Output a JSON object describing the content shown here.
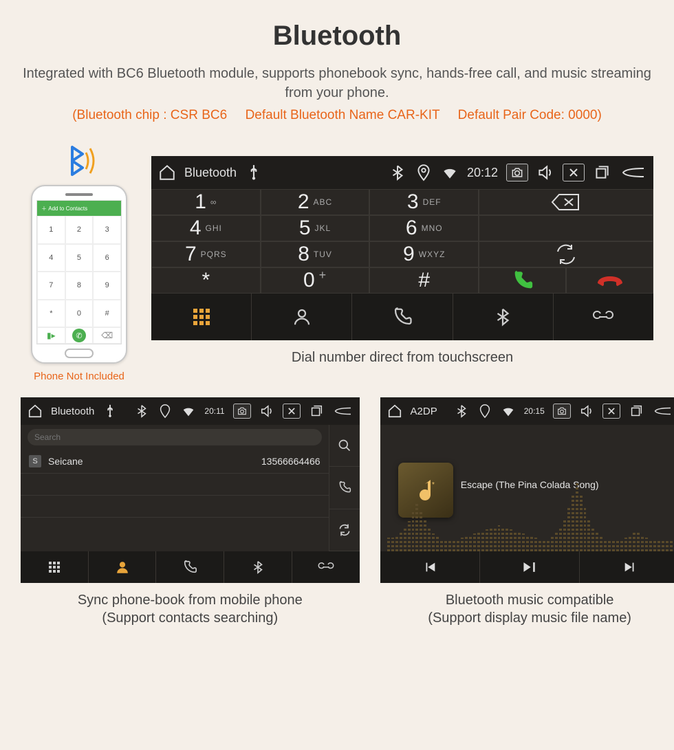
{
  "header": {
    "title": "Bluetooth",
    "subtitle": "Integrated with BC6 Bluetooth module, supports phonebook sync, hands-free call, and music streaming from your phone.",
    "spec_chip": "(Bluetooth chip : CSR BC6",
    "spec_name": "Default Bluetooth Name CAR-KIT",
    "spec_pair": "Default Pair Code: 0000)"
  },
  "phone": {
    "top_label": "Add to Contacts",
    "keys": [
      "1",
      "2",
      "3",
      "4",
      "5",
      "6",
      "7",
      "8",
      "9",
      "*",
      "0",
      "#"
    ],
    "not_included": "Phone Not Included"
  },
  "dialer": {
    "app_title": "Bluetooth",
    "time": "20:12",
    "keys": [
      {
        "n": "1",
        "s": "∞"
      },
      {
        "n": "2",
        "s": "ABC"
      },
      {
        "n": "3",
        "s": "DEF"
      },
      {
        "n": "4",
        "s": "GHI"
      },
      {
        "n": "5",
        "s": "JKL"
      },
      {
        "n": "6",
        "s": "MNO"
      },
      {
        "n": "7",
        "s": "PQRS"
      },
      {
        "n": "8",
        "s": "TUV"
      },
      {
        "n": "9",
        "s": "WXYZ"
      },
      {
        "n": "*",
        "s": ""
      },
      {
        "n": "0",
        "s": "+"
      },
      {
        "n": "#",
        "s": ""
      }
    ],
    "caption": "Dial number direct from touchscreen"
  },
  "phonebook": {
    "app_title": "Bluetooth",
    "time": "20:11",
    "search_placeholder": "Search",
    "contact_letter": "S",
    "contact_name": "Seicane",
    "contact_number": "13566664466",
    "caption_l1": "Sync phone-book from mobile phone",
    "caption_l2": "(Support contacts searching)"
  },
  "a2dp": {
    "app_title": "A2DP",
    "time": "20:15",
    "song": "Escape (The Pina Colada Song)",
    "caption_l1": "Bluetooth music compatible",
    "caption_l2": "(Support display music file name)"
  },
  "viz_heights": [
    20,
    20,
    22,
    28,
    34,
    44,
    58,
    72,
    60,
    46,
    34,
    26,
    22,
    18,
    18,
    16,
    16,
    18,
    20,
    22,
    24,
    26,
    28,
    30,
    32,
    34,
    36,
    38,
    36,
    34,
    32,
    30,
    28,
    26,
    24,
    22,
    20,
    18,
    18,
    18,
    22,
    28,
    36,
    48,
    64,
    84,
    100,
    84,
    64,
    48,
    36,
    28,
    22,
    18,
    18,
    16,
    16,
    18,
    20,
    24,
    30,
    28,
    24,
    20,
    18,
    16,
    16,
    16,
    16,
    16
  ]
}
